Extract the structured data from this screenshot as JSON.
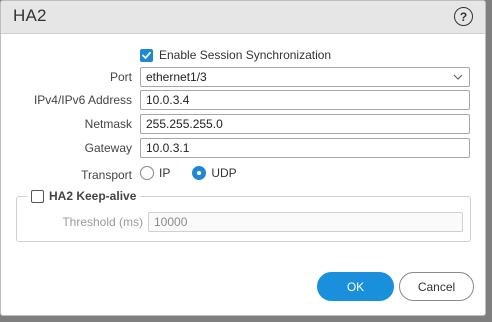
{
  "dialog": {
    "title": "HA2",
    "help_icon": "question-circle-icon",
    "help_glyph": "?"
  },
  "form": {
    "enable_sync": {
      "label": "Enable Session Synchronization",
      "checked": true
    },
    "port": {
      "label": "Port",
      "value": "ethernet1/3"
    },
    "address": {
      "label": "IPv4/IPv6 Address",
      "value": "10.0.3.4"
    },
    "netmask": {
      "label": "Netmask",
      "value": "255.255.255.0"
    },
    "gateway": {
      "label": "Gateway",
      "value": "10.0.3.1"
    },
    "transport": {
      "label": "Transport",
      "options": [
        {
          "label": "IP",
          "selected": false
        },
        {
          "label": "UDP",
          "selected": true
        }
      ]
    },
    "keepalive": {
      "legend": "HA2 Keep-alive",
      "checked": false,
      "threshold": {
        "label": "Threshold (ms)",
        "value": "10000"
      }
    }
  },
  "buttons": {
    "ok": "OK",
    "cancel": "Cancel"
  },
  "colors": {
    "accent": "#1a8fdc",
    "titlebar": "#e6e6e6"
  }
}
